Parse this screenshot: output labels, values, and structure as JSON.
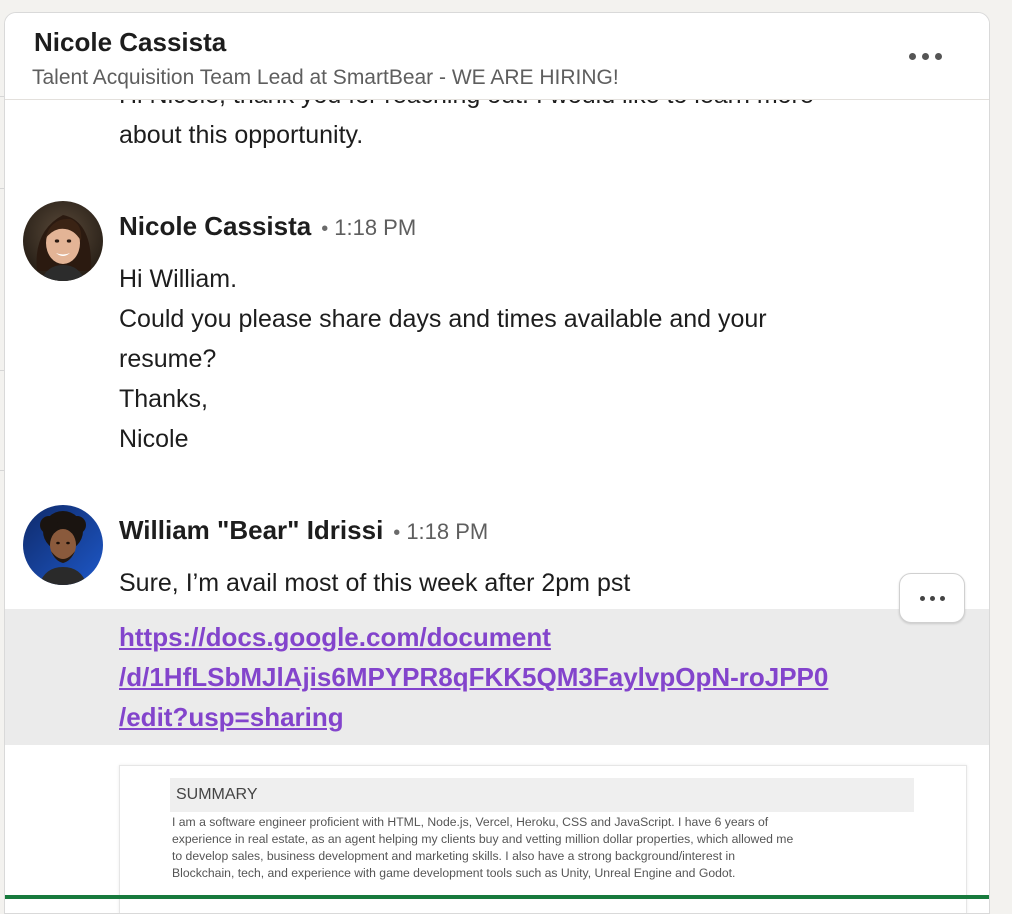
{
  "header": {
    "name": "Nicole Cassista",
    "subtitle": "Talent Acquisition Team Lead at SmartBear - WE ARE HIRING!"
  },
  "previous_message": {
    "line_1": "Hi Nicole, thank you for reaching out. I would like to learn more",
    "line_2": "about this opportunity."
  },
  "messages": [
    {
      "sender": "Nicole Cassista",
      "separator": "•",
      "time": "1:18 PM",
      "lines": [
        "Hi William.",
        "Could you please share days and times available and your",
        "resume?",
        "Thanks,",
        "Nicole"
      ]
    },
    {
      "sender": "William \"Bear\" Idrissi",
      "separator": "•",
      "time": "1:18 PM",
      "lines": [
        "Sure, I’m avail most of this week after 2pm pst"
      ],
      "link_lines": [
        "https://docs.google.com/document",
        "/d/1HfLSbMJlAjis6MPYPR8qFKK5QM3FaylvpOpN-roJPP0",
        "/edit?usp=sharing"
      ]
    }
  ],
  "preview": {
    "heading": "SUMMARY",
    "lines": [
      "I am a software engineer proficient with HTML, Node.js, Vercel, Heroku, CSS and JavaScript. I have 6 years of",
      "experience in real estate, as an agent helping my clients buy and vetting million dollar properties, which allowed me",
      "to develop sales, business development and marketing skills. I also have a strong background/interest in",
      "Blockchain, tech, and experience with game development tools such as Unity, Unreal Engine and Godot."
    ]
  },
  "colors": {
    "link": "#8344cc",
    "link_row_background": "#ebebeb",
    "bottom_bar": "#177a3d"
  },
  "icons": {
    "header_more": "more-horizontal-icon",
    "message_more": "more-horizontal-icon"
  }
}
